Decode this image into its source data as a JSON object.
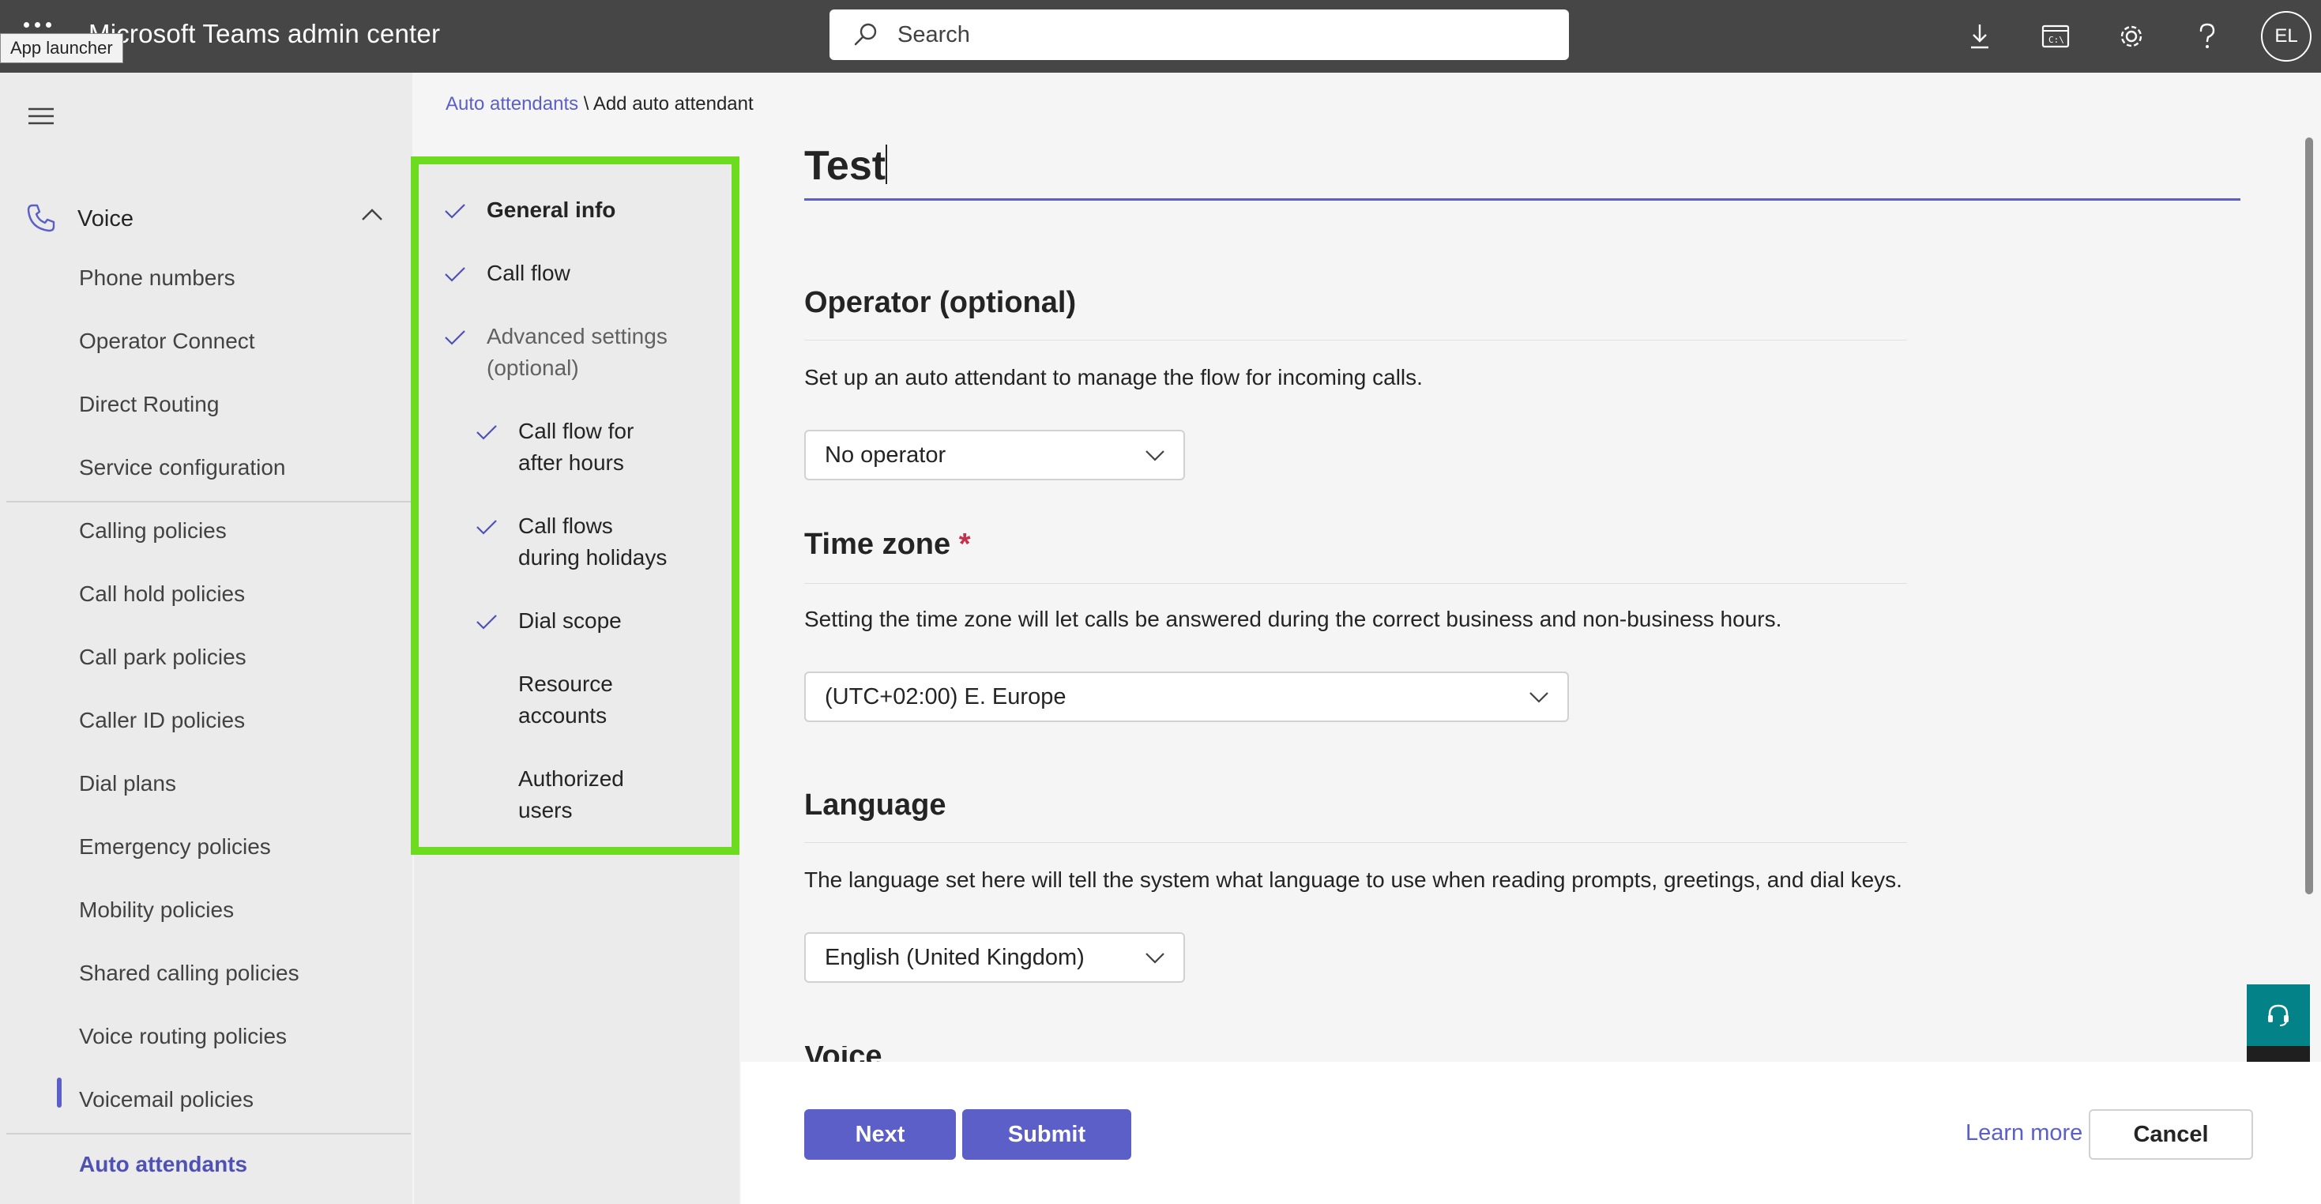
{
  "header": {
    "app_title": "Microsoft Teams admin center",
    "tooltip": "App launcher",
    "search_placeholder": "Search",
    "avatar_initials": "EL",
    "icons": [
      "waffle-icon",
      "search-icon",
      "download-icon",
      "console-icon",
      "gear-icon",
      "help-icon"
    ]
  },
  "nav": {
    "section": "Voice",
    "items": [
      "Phone numbers",
      "Operator Connect",
      "Direct Routing",
      "Service configuration",
      "Calling policies",
      "Call hold policies",
      "Call park policies",
      "Caller ID policies",
      "Dial plans",
      "Emergency policies",
      "Mobility policies",
      "Shared calling policies",
      "Voice routing policies",
      "Voicemail policies"
    ],
    "active_item": "Auto attendants"
  },
  "breadcrumb": {
    "link": "Auto attendants",
    "separator": " \\ ",
    "current": "Add auto attendant"
  },
  "steps": {
    "general_info": "General info",
    "call_flow": "Call flow",
    "advanced_1": "Advanced settings",
    "advanced_2": "(optional)",
    "after_hours_1": "Call flow for",
    "after_hours_2": "after hours",
    "holidays_1": "Call flows",
    "holidays_2": "during holidays",
    "dial_scope": "Dial scope",
    "resource_1": "Resource",
    "resource_2": "accounts",
    "authorized_1": "Authorized",
    "authorized_2": "users"
  },
  "form": {
    "name_value": "Test",
    "operator": {
      "heading": "Operator (optional)",
      "description": "Set up an auto attendant to manage the flow for incoming calls.",
      "selected": "No operator"
    },
    "timezone": {
      "heading": "Time zone",
      "required_mark": "*",
      "description": "Setting the time zone will let calls be answered during the correct business and non-business hours.",
      "selected": "(UTC+02:00) E. Europe"
    },
    "language": {
      "heading": "Language",
      "description": "The language set here will tell the system what language to use when reading prompts, greetings, and dial keys.",
      "selected": "English (United Kingdom)"
    },
    "next_heading_partial": "Voice input"
  },
  "footer": {
    "next": "Next",
    "submit": "Submit",
    "learn_more": "Learn more",
    "cancel": "Cancel"
  },
  "colors": {
    "accent": "#5b5fc7",
    "header_bg": "#464646",
    "highlight_border": "#6edc1e",
    "fab_teal": "#038387"
  }
}
